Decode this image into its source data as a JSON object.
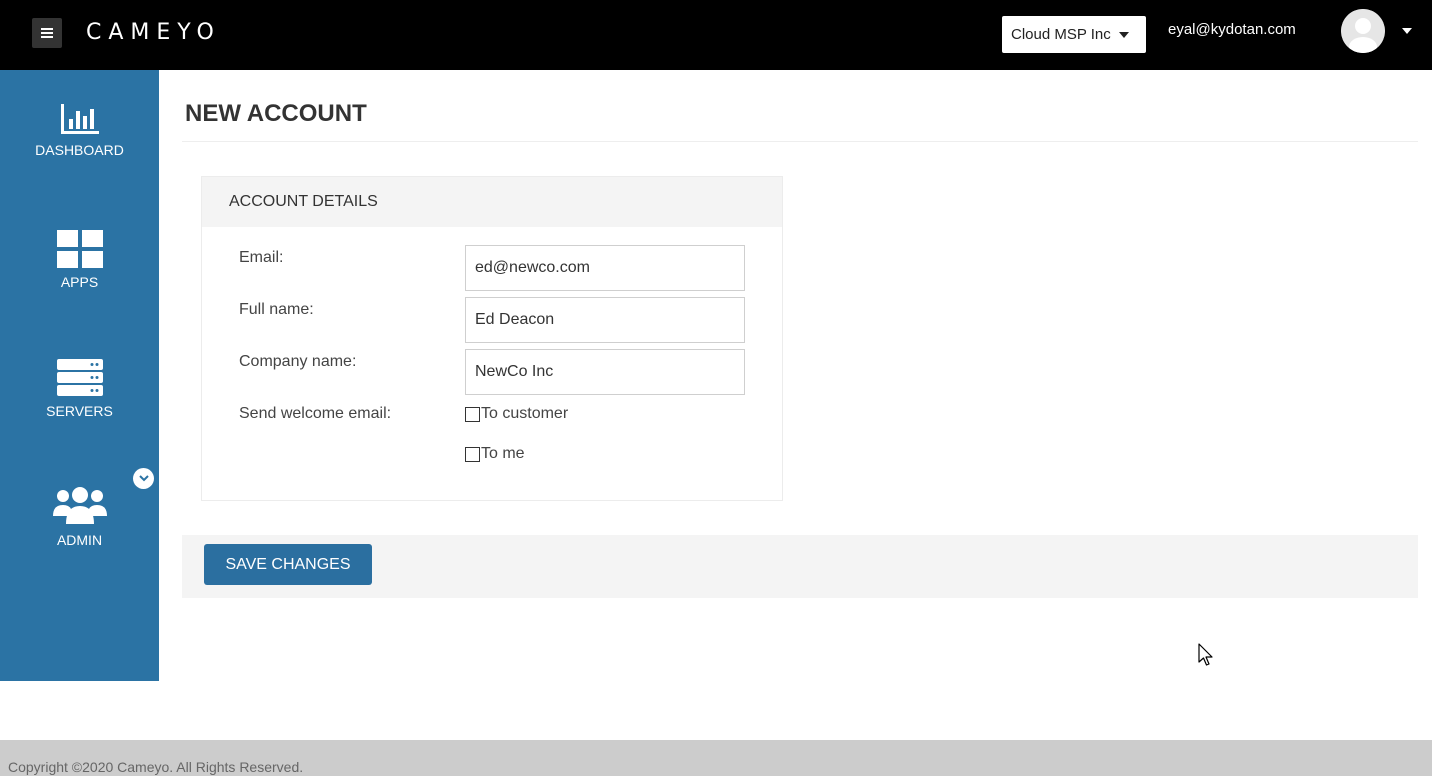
{
  "header": {
    "brand": "CAMEYO",
    "org_selector": "Cloud MSP Inc",
    "user_email": "eyal@kydotan.com"
  },
  "sidebar": {
    "items": [
      {
        "label": "DASHBOARD",
        "icon": "bar-chart-icon"
      },
      {
        "label": "APPS",
        "icon": "grid-icon"
      },
      {
        "label": "SERVERS",
        "icon": "server-icon"
      },
      {
        "label": "ADMIN",
        "icon": "users-icon"
      }
    ]
  },
  "main": {
    "page_title": "NEW ACCOUNT",
    "panel_title": "ACCOUNT DETAILS",
    "fields": {
      "email_label": "Email:",
      "email_value": "ed@newco.com",
      "fullname_label": "Full name:",
      "fullname_value": "Ed Deacon",
      "company_label": "Company name:",
      "company_value": "NewCo Inc",
      "welcome_label": "Send welcome email:",
      "to_customer_label": "To customer",
      "to_customer_checked": false,
      "to_me_label": "To me",
      "to_me_checked": false
    },
    "save_label": "SAVE CHANGES"
  },
  "footer": {
    "copyright": "Copyright ©2020 Cameyo. All Rights Reserved."
  },
  "colors": {
    "topbar": "#000000",
    "sidebar": "#2b73a4",
    "primary_button": "#2b6fa0",
    "footer": "#cccccc"
  }
}
